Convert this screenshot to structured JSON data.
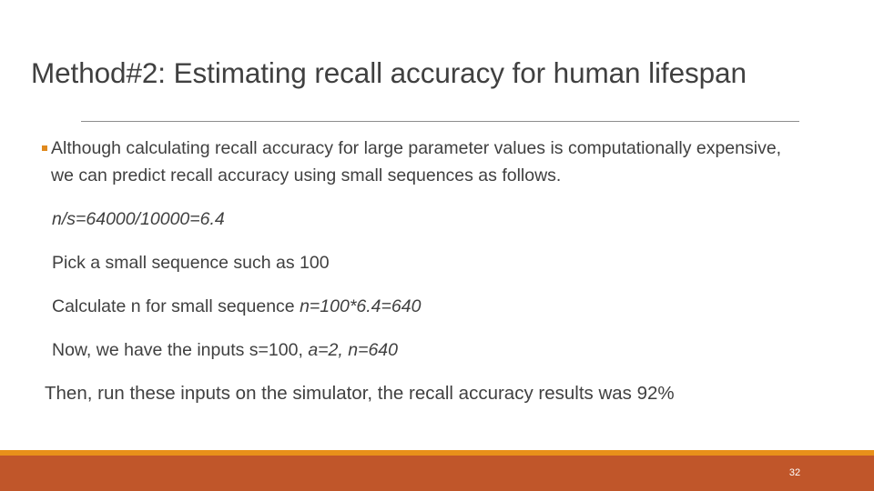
{
  "slide": {
    "title": "Method#2: Estimating recall accuracy for human lifespan",
    "bullet_glyph": "square-bullet",
    "colors": {
      "background": "#ffffff",
      "text": "#404040",
      "bullet": "#E08A1E",
      "rule": "#8c8c8c",
      "footer_stripe": "#E8901A",
      "footer_bar": "#C0562A",
      "page_number": "#ffffff"
    },
    "body": {
      "bullet_paragraph": "Although calculating recall accuracy for large parameter values is computationally expensive, we can predict recall accuracy using small sequences as follows.",
      "line_ratio": "n/s=64000/10000=6.4",
      "line_pick": "Pick a small sequence such as 100",
      "line_calculate_prefix": "Calculate n for small sequence ",
      "line_calculate_formula": "n=100*6.4=640",
      "line_inputs_prefix": "Now, we have the inputs s=100, ",
      "line_inputs_formula": "a=2, n=640",
      "line_result": "Then, run these inputs on the simulator, the recall accuracy results was 92%"
    },
    "footer": {
      "page_number": "32"
    }
  }
}
